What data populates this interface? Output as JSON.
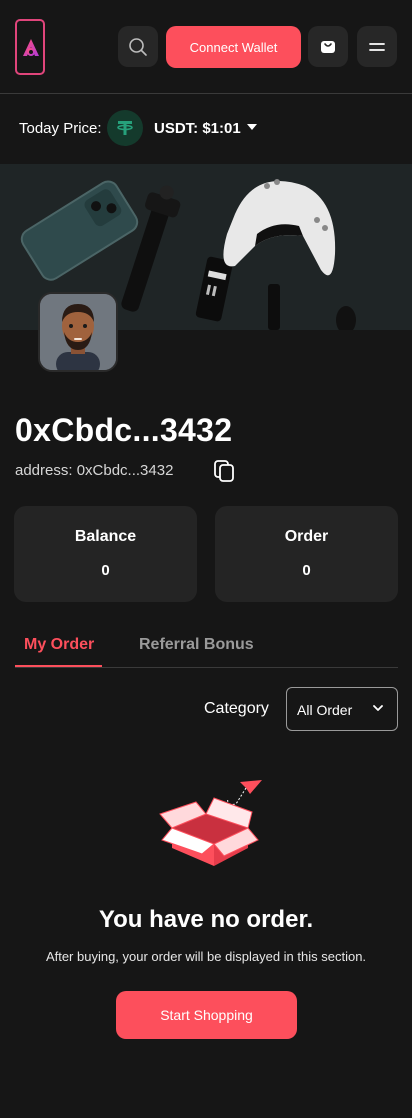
{
  "header": {
    "connect_wallet_label": "Connect Wallet",
    "accent_color": "#fd4f5c"
  },
  "price": {
    "label": "Today Price:",
    "value": "USDT: $1:01",
    "token_icon": "tether-icon"
  },
  "profile": {
    "address_title": "0xCbdc...3432",
    "address_line": "address: 0xCbdc...3432"
  },
  "stats": {
    "balance_label": "Balance",
    "balance_value": "0",
    "order_label": "Order",
    "order_value": "0"
  },
  "tabs": [
    {
      "label": "My Order",
      "active": true
    },
    {
      "label": "Referral Bonus",
      "active": false
    }
  ],
  "filter": {
    "category_label": "Category",
    "selected": "All Order"
  },
  "empty_state": {
    "title": "You have no order.",
    "description": "After buying, your order will be displayed in this section.",
    "button_label": "Start Shopping"
  }
}
